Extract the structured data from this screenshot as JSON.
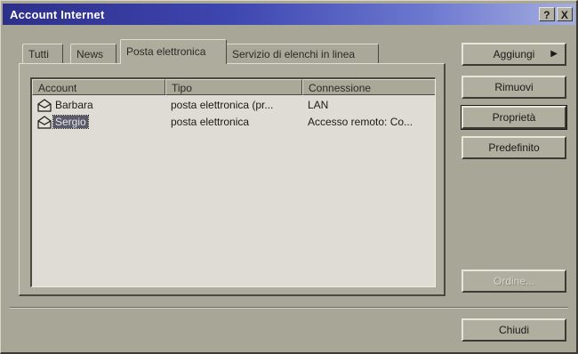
{
  "window": {
    "title": "Account Internet",
    "help_label": "?",
    "close_label": "X"
  },
  "tabs": [
    {
      "label": "Tutti",
      "active": false
    },
    {
      "label": "News",
      "active": false
    },
    {
      "label": "Posta elettronica",
      "active": true
    },
    {
      "label": "Servizio di elenchi in linea",
      "active": false
    }
  ],
  "list": {
    "columns": [
      "Account",
      "Tipo",
      "Connessione"
    ],
    "rows": [
      {
        "account": "Barbara",
        "tipo": "posta elettronica (pr...",
        "connessione": "LAN",
        "selected": false,
        "icon": "mail-account-icon"
      },
      {
        "account": "Sergio",
        "tipo": "posta elettronica",
        "connessione": "Accesso remoto: Co...",
        "selected": true,
        "icon": "mail-account-icon"
      }
    ]
  },
  "buttons": {
    "add": "Aggiungi",
    "add_arrow": "▶",
    "remove": "Rimuovi",
    "properties": "Proprietà",
    "default": "Predefinito",
    "order": "Ordine...",
    "close": "Chiudi"
  }
}
